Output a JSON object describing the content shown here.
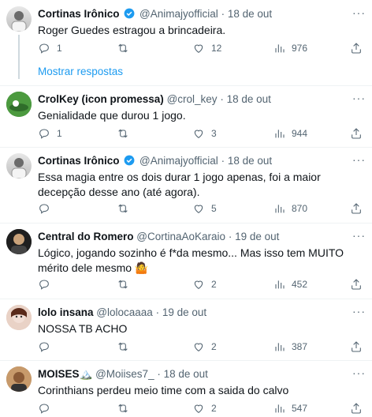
{
  "show_replies_label": "Mostrar respostas",
  "tweets": [
    {
      "name": "Cortinas Irônico",
      "handle": "@Animajyofficial",
      "time": "18 de out",
      "text": "Roger Guedes estragou a brincadeira.",
      "replies": "1",
      "retweets": "",
      "likes": "12",
      "views": "976"
    },
    {
      "name": "CrolKey (icon promessa)",
      "handle": "@crol_key",
      "time": "18 de out",
      "text": "Genialidade que durou 1 jogo.",
      "replies": "1",
      "retweets": "",
      "likes": "3",
      "views": "944"
    },
    {
      "name": "Cortinas Irônico",
      "handle": "@Animajyofficial",
      "time": "18 de out",
      "text": "Essa magia entre os dois durar 1 jogo apenas, foi a maior decepção desse ano (até agora).",
      "replies": "",
      "retweets": "",
      "likes": "5",
      "views": "870"
    },
    {
      "name": "Central do Romero",
      "handle": "@CortinaAoKaraio",
      "time": "19 de out",
      "text": "Lógico, jogando sozinho é f*da mesmo... Mas isso tem MUITO mérito dele mesmo 🤷",
      "replies": "",
      "retweets": "",
      "likes": "2",
      "views": "452"
    },
    {
      "name": "lolo insana",
      "handle": "@lolocaaaa",
      "time": "19 de out",
      "text": "NOSSA TB ACHO",
      "replies": "",
      "retweets": "",
      "likes": "2",
      "views": "387"
    },
    {
      "name": "MOISES🏔️",
      "handle": "@Moiises7_",
      "time": "18 de out",
      "text": "Corinthians perdeu meio time com a saida do calvo",
      "replies": "",
      "retweets": "",
      "likes": "2",
      "views": "547"
    }
  ],
  "colors": {
    "link": "#1d9bf0",
    "muted": "#536471",
    "verified": "#1d9bf0"
  },
  "icons": [
    "reply-icon",
    "retweet-icon",
    "like-icon",
    "views-icon",
    "share-icon",
    "more-icon",
    "verified-badge-icon"
  ]
}
